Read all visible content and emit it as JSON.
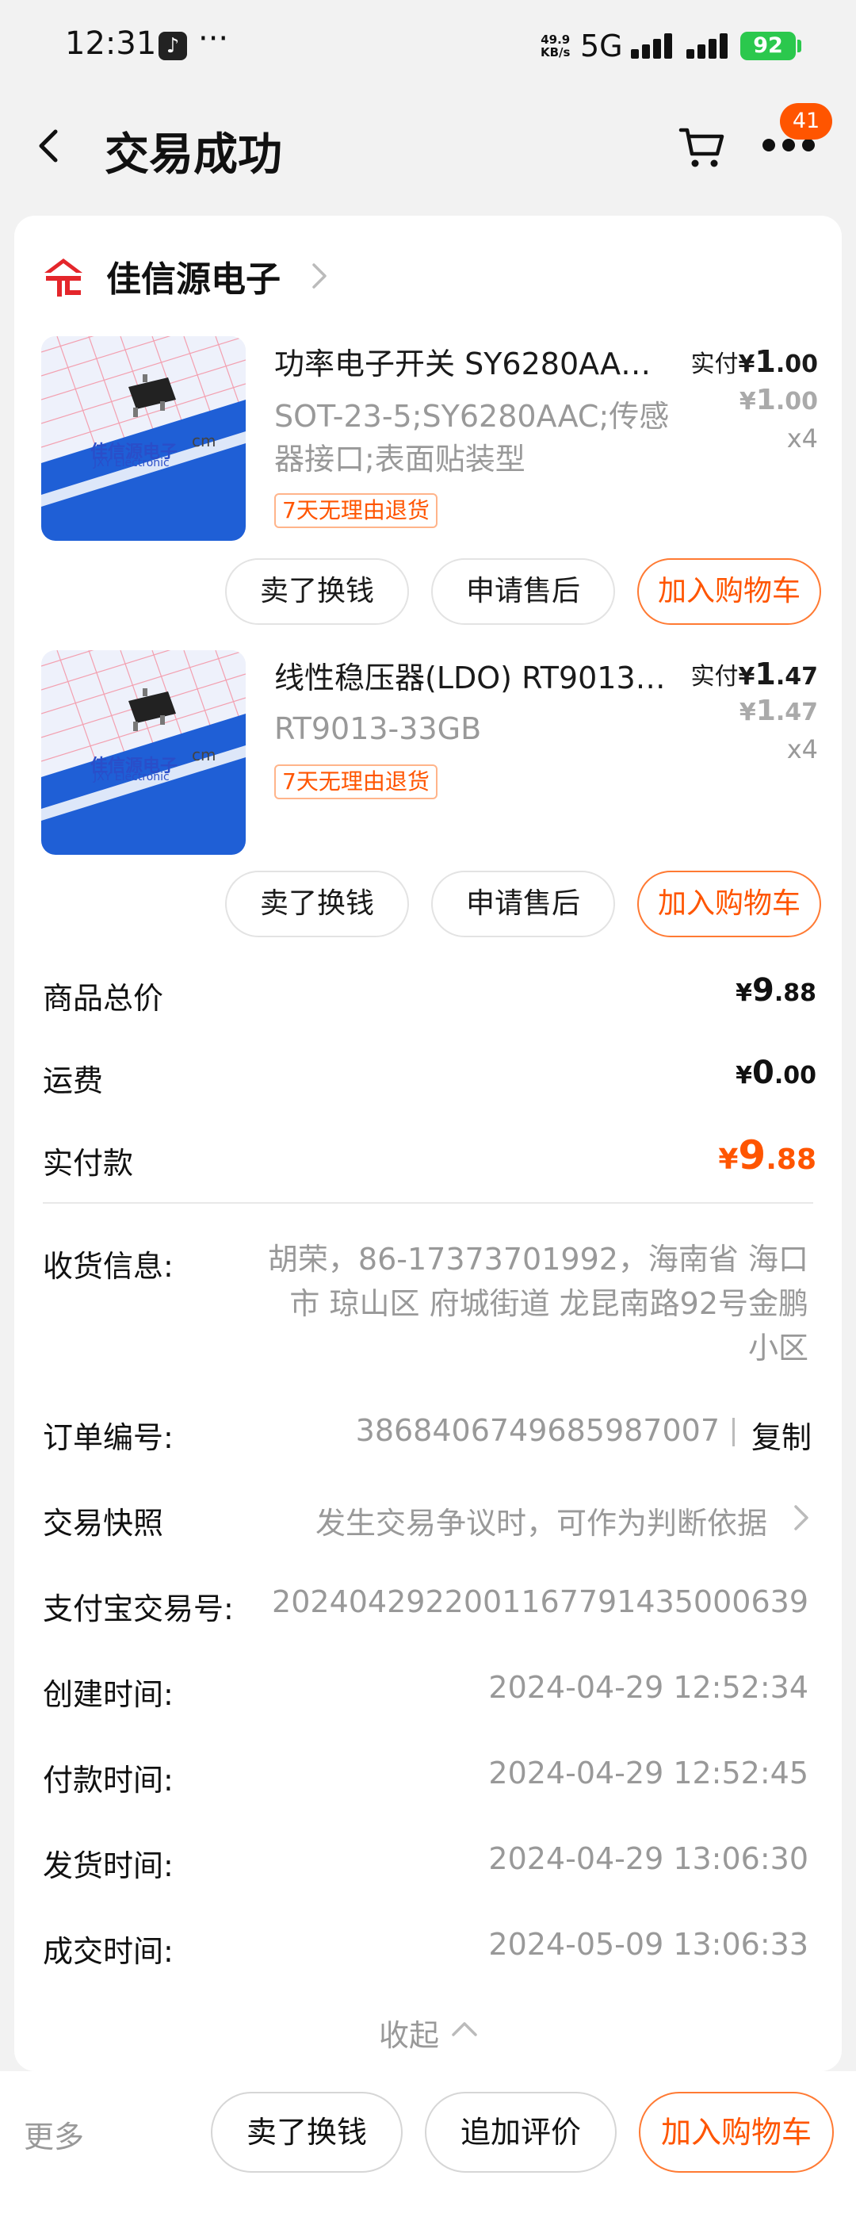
{
  "status_bar": {
    "time": "12:31",
    "app_icon_glyph": "♪",
    "more": "···",
    "speed_value": "49.9",
    "speed_unit": "KB/s",
    "network": "5G",
    "battery": "92"
  },
  "nav": {
    "title": "交易成功",
    "badge_count": "41"
  },
  "shop": {
    "name": "佳信源电子"
  },
  "products": [
    {
      "title": "功率电子开关 SY6280AA…",
      "spec": "SOT-23-5;SY6280AAC;传感器接口;表面贴装型",
      "return_badge": "7天无理由退货",
      "paid_label": "实付",
      "paid_yen": "¥",
      "paid_int": "1",
      "paid_dec": ".00",
      "orig_yen": "¥",
      "orig_int": "1",
      "orig_dec": ".00",
      "qty": "x4",
      "thumb_text": "佳信源电子",
      "thumb_sub": "JXY Electronic",
      "thumb_unit": "cm",
      "buttons": {
        "sell": "卖了换钱",
        "after_sale": "申请售后",
        "add_cart": "加入购物车"
      }
    },
    {
      "title": "线性稳压器(LDO) RT9013…",
      "spec": "RT9013-33GB",
      "return_badge": "7天无理由退货",
      "paid_label": "实付",
      "paid_yen": "¥",
      "paid_int": "1",
      "paid_dec": ".47",
      "orig_yen": "¥",
      "orig_int": "1",
      "orig_dec": ".47",
      "qty": "x4",
      "thumb_text": "佳信源电子",
      "thumb_sub": "JXY Electronic",
      "thumb_unit": "cm",
      "buttons": {
        "sell": "卖了换钱",
        "after_sale": "申请售后",
        "add_cart": "加入购物车"
      }
    }
  ],
  "summary": {
    "goods_total_label": "商品总价",
    "goods_total": {
      "yen": "¥",
      "int": "9",
      "dec": ".88"
    },
    "shipping_label": "运费",
    "shipping": {
      "yen": "¥",
      "int": "0",
      "dec": ".00"
    },
    "paid_label": "实付款",
    "paid": {
      "yen": "¥",
      "int": "9",
      "dec": ".88"
    }
  },
  "order_info": {
    "address_label": "收货信息:",
    "address": "胡荣，86-17373701992，海南省 海口市 琼山区 府城街道 龙昆南路92号金鹏小区",
    "order_no_label": "订单编号:",
    "order_no": "3868406749685987007",
    "copy_label": "复制",
    "snapshot_label": "交易快照",
    "snapshot_hint": "发生交易争议时，可作为判断依据",
    "alipay_label": "支付宝交易号:",
    "alipay_no": "2024042922001167791435000639",
    "created_label": "创建时间:",
    "created": "2024-04-29 12:52:34",
    "paid_time_label": "付款时间:",
    "paid_time": "2024-04-29 12:52:45",
    "shipped_label": "发货时间:",
    "shipped": "2024-04-29 13:06:30",
    "closed_label": "成交时间:",
    "closed": "2024-05-09 13:06:33",
    "collapse_label": "收起"
  },
  "bottom_bar": {
    "more": "更多",
    "sell": "卖了换钱",
    "review": "追加评价",
    "add_cart": "加入购物车"
  },
  "colors": {
    "accent": "#ff5500",
    "shop_logo": "#e4262b",
    "battery": "#2bc84d"
  }
}
